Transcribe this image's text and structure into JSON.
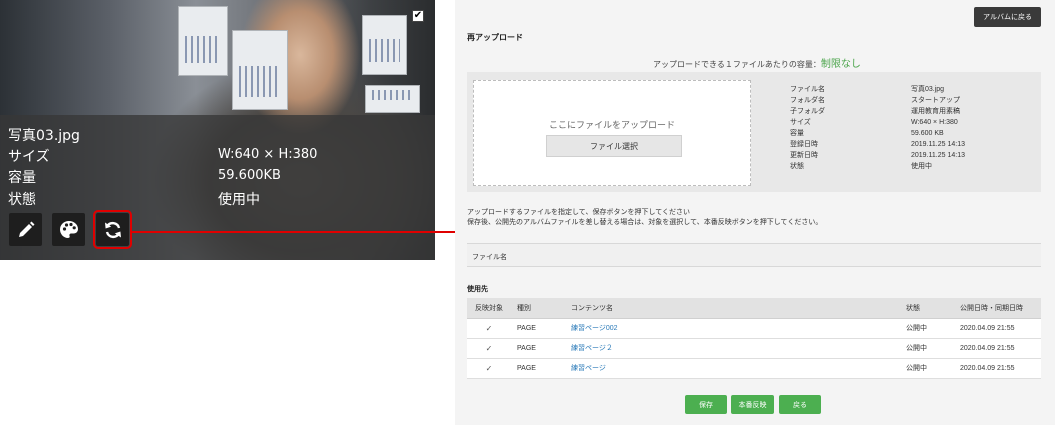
{
  "photo_card": {
    "file_name": "写真03.jpg",
    "size_label": "サイズ",
    "size_value": "W:640 × H:380",
    "capacity_label": "容量",
    "capacity_value": "59.600KB",
    "status_label": "状態",
    "status_value": "使用中",
    "check_mark": "✔"
  },
  "tools": {
    "edit_icon": "pencil-icon",
    "palette_icon": "palette-icon",
    "replace_icon": "refresh-icon"
  },
  "panel": {
    "back_album_button": "アルバムに戻る",
    "section_title": "再アップロード",
    "capacity_caption": "アップロードできる１ファイルあたりの容量：",
    "capacity_limit": "制限なし",
    "dropzone_text": "ここにファイルをアップロード",
    "file_select_button": "ファイル選択",
    "meta_labels": [
      "ファイル名",
      "フォルダ名",
      "子フォルダ",
      "サイズ",
      "容量",
      "登録日時",
      "更新日時",
      "状態"
    ],
    "meta_values": [
      "写真03.jpg",
      "スタートアップ",
      "運用教育用素稿",
      "W:640 × H:380",
      "59.600 KB",
      "2019.11.25 14:13",
      "2019.11.25 14:13",
      "使用中"
    ],
    "note_line1": "アップロードするファイルを指定して、保存ボタンを押下してください",
    "note_line2": "保存後、公開先のアルバムファイルを差し替える場合は、対象を選択して、本番反映ボタンを押下してください。",
    "filename_label": "ファイル名",
    "usage_title": "使用先",
    "table_headers": {
      "target": "反映対象",
      "type": "種別",
      "content": "コンテンツ名",
      "status": "状態",
      "date": "公開日時・同期日時"
    },
    "rows": [
      {
        "check": "✓",
        "type": "PAGE",
        "content": "練習ページ002",
        "status": "公開中",
        "date": "2020.04.09 21:55"
      },
      {
        "check": "✓",
        "type": "PAGE",
        "content": "練習ページ２",
        "status": "公開中",
        "date": "2020.04.09 21:55"
      },
      {
        "check": "✓",
        "type": "PAGE",
        "content": "練習ページ",
        "status": "公開中",
        "date": "2020.04.09 21:55"
      }
    ],
    "save_button": "保存",
    "publish_button": "本番反映",
    "back_button": "戻る"
  },
  "colors": {
    "accent_green": "#4caf50",
    "limit_green": "#4aa44a",
    "highlight_red": "#e00000",
    "link_blue": "#2a7ab8"
  }
}
